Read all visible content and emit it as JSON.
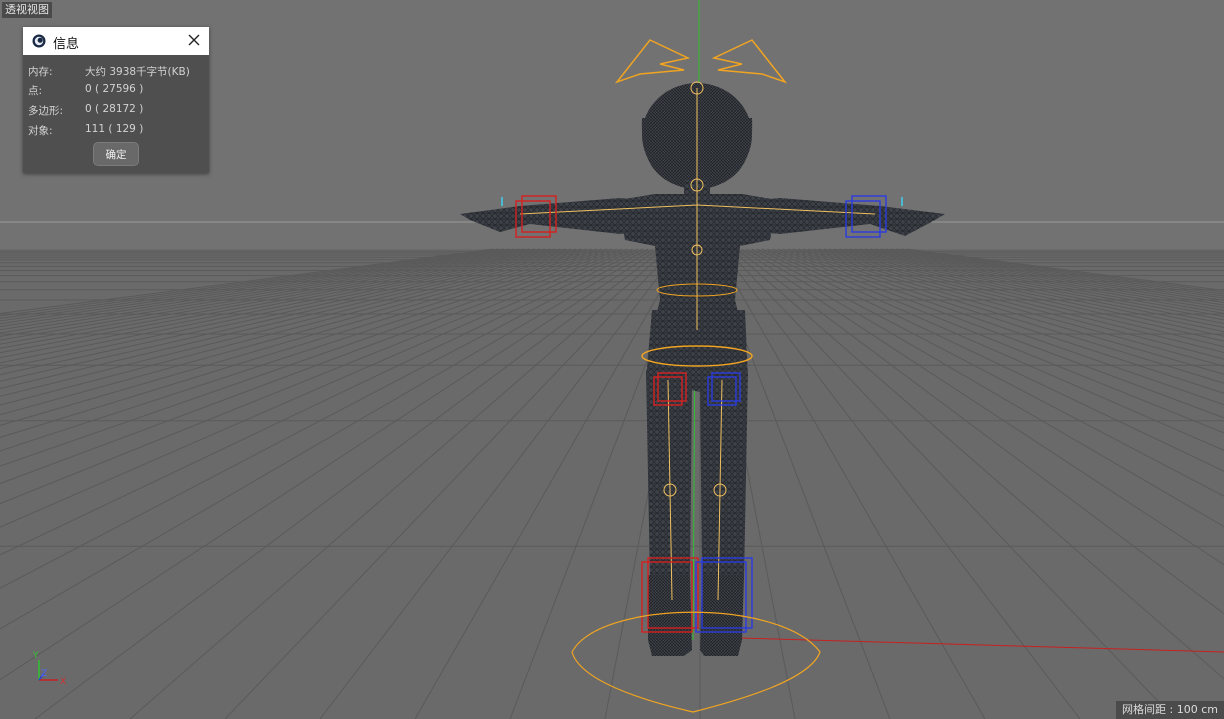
{
  "viewport": {
    "view_label": "透视视图",
    "grid_distance_label": "网格间距 : 100 cm",
    "axis_labels": {
      "y": "Y",
      "z": "Z",
      "x": "X"
    }
  },
  "info_dialog": {
    "title": "信息",
    "rows": [
      {
        "key": "内存:",
        "value": "大约 3938千字节(KB)"
      },
      {
        "key": "点:",
        "value": "0 ( 27596 )"
      },
      {
        "key": "多边形:",
        "value": "0 ( 28172 )"
      },
      {
        "key": "对象:",
        "value": "111 ( 129 )"
      }
    ],
    "ok_label": "确定"
  },
  "colors": {
    "viewport_bg": "#727272",
    "floor": "#6b6b6b",
    "grid_line": "#5c5c5c",
    "mesh_fill": "#3c4047",
    "mesh_wire": "#1e2126",
    "joint_orange": "#f0a422",
    "ctrl_red": "#d62020",
    "ctrl_blue": "#2a3be0",
    "axis_green": "#29c229",
    "axis_red": "#c82020"
  }
}
